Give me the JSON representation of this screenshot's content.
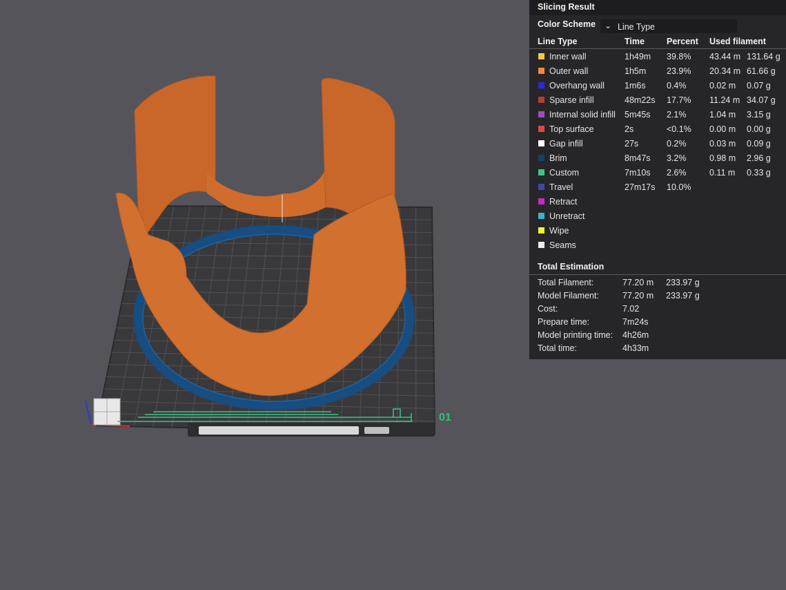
{
  "viewport": {
    "plate_label": "01"
  },
  "panel": {
    "title": "Slicing Result",
    "color_scheme_label": "Color Scheme",
    "color_scheme_value": "Line Type",
    "columns": {
      "line_type": "Line Type",
      "time": "Time",
      "percent": "Percent",
      "used_filament": "Used filament"
    },
    "rows": [
      {
        "name": "Inner wall",
        "color": "#f2c84b",
        "time": "1h49m",
        "percent": "39.8%",
        "length": "43.44 m",
        "weight": "131.64 g"
      },
      {
        "name": "Outer wall",
        "color": "#f08a3c",
        "time": "1h5m",
        "percent": "23.9%",
        "length": "20.34 m",
        "weight": "61.66 g"
      },
      {
        "name": "Overhang wall",
        "color": "#2a2ad6",
        "time": "1m6s",
        "percent": "0.4%",
        "length": "0.02 m",
        "weight": "0.07 g"
      },
      {
        "name": "Sparse infill",
        "color": "#b0403a",
        "time": "48m22s",
        "percent": "17.7%",
        "length": "11.24 m",
        "weight": "34.07 g"
      },
      {
        "name": "Internal solid infill",
        "color": "#9b4fc4",
        "time": "5m45s",
        "percent": "2.1%",
        "length": "1.04 m",
        "weight": "3.15 g"
      },
      {
        "name": "Top surface",
        "color": "#e04848",
        "time": "2s",
        "percent": "<0.1%",
        "length": "0.00 m",
        "weight": "0.00 g"
      },
      {
        "name": "Gap infill",
        "color": "#ffffff",
        "time": "27s",
        "percent": "0.2%",
        "length": "0.03 m",
        "weight": "0.09 g"
      },
      {
        "name": "Brim",
        "color": "#14406e",
        "time": "8m47s",
        "percent": "3.2%",
        "length": "0.98 m",
        "weight": "2.96 g"
      },
      {
        "name": "Custom",
        "color": "#3ec486",
        "time": "7m10s",
        "percent": "2.6%",
        "length": "0.11 m",
        "weight": "0.33 g"
      },
      {
        "name": "Travel",
        "color": "#3d4aa8",
        "time": "27m17s",
        "percent": "10.0%",
        "length": "",
        "weight": ""
      },
      {
        "name": "Retract",
        "color": "#c72ac2",
        "time": "",
        "percent": "",
        "length": "",
        "weight": ""
      },
      {
        "name": "Unretract",
        "color": "#3fb0cf",
        "time": "",
        "percent": "",
        "length": "",
        "weight": ""
      },
      {
        "name": "Wipe",
        "color": "#f2f23a",
        "time": "",
        "percent": "",
        "length": "",
        "weight": ""
      },
      {
        "name": "Seams",
        "color": "#ececec",
        "time": "",
        "percent": "",
        "length": "",
        "weight": ""
      }
    ],
    "total_estimation": {
      "title": "Total Estimation",
      "items": [
        {
          "label": "Total Filament:",
          "value1": "77.20 m",
          "value2": "233.97 g"
        },
        {
          "label": "Model Filament:",
          "value1": "77.20 m",
          "value2": "233.97 g"
        },
        {
          "label": "Cost:",
          "value1": "7.02",
          "value2": ""
        },
        {
          "label": "Prepare time:",
          "value1": "7m24s",
          "value2": ""
        },
        {
          "label": "Model printing time:",
          "value1": "4h26m",
          "value2": ""
        },
        {
          "label": "Total time:",
          "value1": "4h33m",
          "value2": ""
        }
      ]
    }
  },
  "colors": {
    "background": "#55545b",
    "model_orange": "#d2702f",
    "brim_blue": "#174d80",
    "plate": "#3a3a3d",
    "accent_green": "#3ec486"
  }
}
